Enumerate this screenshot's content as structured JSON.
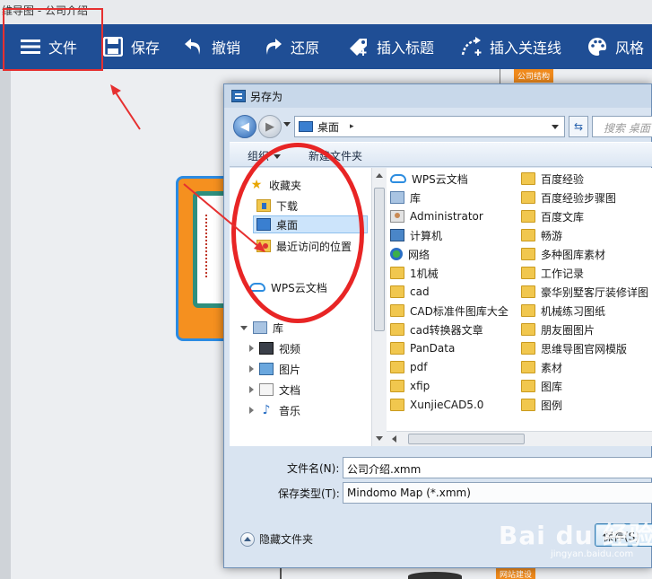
{
  "app": {
    "window_title": "维导图 - 公司介绍",
    "toolbar": [
      {
        "label": "文件",
        "icon": "menu-icon"
      },
      {
        "label": "保存",
        "icon": "save-icon"
      },
      {
        "label": "撤销",
        "icon": "undo-icon"
      },
      {
        "label": "还原",
        "icon": "redo-icon"
      },
      {
        "label": "插入标题",
        "icon": "tag-icon"
      },
      {
        "label": "插入关连线",
        "icon": "connector-icon"
      },
      {
        "label": "风格",
        "icon": "palette-icon"
      }
    ],
    "canvas": {
      "node_tag_top": "公司结构",
      "node_tag_bottom": "网站建设"
    }
  },
  "dialog": {
    "title": "另存为",
    "address": {
      "location": "桌面",
      "separator": "▸"
    },
    "search_placeholder": "搜索 桌面",
    "commands": {
      "organize": "组织",
      "new_folder": "新建文件夹"
    },
    "nav_tree": [
      {
        "label": "收藏夹",
        "icon": "star-icon"
      },
      {
        "label": "下载",
        "icon": "downloads-folder-icon"
      },
      {
        "label": "桌面",
        "icon": "desktop-icon",
        "selected": true
      },
      {
        "label": "最近访问的位置",
        "icon": "recent-places-icon"
      },
      {
        "label": "WPS云文档",
        "icon": "cloud-icon"
      },
      {
        "label": "库",
        "icon": "library-icon"
      },
      {
        "label": "视频",
        "icon": "video-icon"
      },
      {
        "label": "图片",
        "icon": "pictures-icon"
      },
      {
        "label": "文档",
        "icon": "documents-icon"
      },
      {
        "label": "音乐",
        "icon": "music-icon"
      }
    ],
    "files_col1": [
      {
        "name": "WPS云文档",
        "icon": "cloud-icon"
      },
      {
        "name": "库",
        "icon": "library-icon"
      },
      {
        "name": "Administrator",
        "icon": "user-folder-icon"
      },
      {
        "name": "计算机",
        "icon": "computer-icon"
      },
      {
        "name": "网络",
        "icon": "network-icon"
      },
      {
        "name": "1机械",
        "icon": "folder-icon"
      },
      {
        "name": "cad",
        "icon": "folder-icon"
      },
      {
        "name": "CAD标准件图库大全",
        "icon": "folder-icon"
      },
      {
        "name": "cad转换器文章",
        "icon": "folder-icon"
      },
      {
        "name": "PanData",
        "icon": "folder-icon"
      },
      {
        "name": "pdf",
        "icon": "folder-icon"
      },
      {
        "name": "xfip",
        "icon": "folder-icon"
      },
      {
        "name": "XunjieCAD5.0",
        "icon": "folder-icon"
      }
    ],
    "files_col2": [
      {
        "name": "百度经验",
        "icon": "folder-icon"
      },
      {
        "name": "百度经验步骤图",
        "icon": "folder-icon"
      },
      {
        "name": "百度文库",
        "icon": "folder-icon"
      },
      {
        "name": "畅游",
        "icon": "folder-icon"
      },
      {
        "name": "多种图库素材",
        "icon": "folder-icon"
      },
      {
        "name": "工作记录",
        "icon": "folder-icon"
      },
      {
        "name": "豪华别墅客厅装修详图",
        "icon": "folder-icon"
      },
      {
        "name": "机械练习图纸",
        "icon": "folder-icon"
      },
      {
        "name": "朋友圈图片",
        "icon": "folder-icon"
      },
      {
        "name": "思维导图官网模版",
        "icon": "folder-icon"
      },
      {
        "name": "素材",
        "icon": "folder-icon"
      },
      {
        "name": "图库",
        "icon": "folder-icon"
      },
      {
        "name": "图例",
        "icon": "folder-icon"
      }
    ],
    "filename_label": "文件名(N):",
    "filename_value": "公司介绍.xmm",
    "filetype_label": "保存类型(T):",
    "filetype_value": "Mindomo Map (*.xmm)",
    "hide_folders_label": "隐藏文件夹",
    "save_button": "保存(S)"
  },
  "watermark": {
    "brand": "Bai du 经验",
    "url": "jingyan.baidu.com"
  },
  "colors": {
    "toolbar": "#1f4e95",
    "annotation_red": "#e63030",
    "node_orange": "#f5901f",
    "selection": "#cce4fb"
  }
}
